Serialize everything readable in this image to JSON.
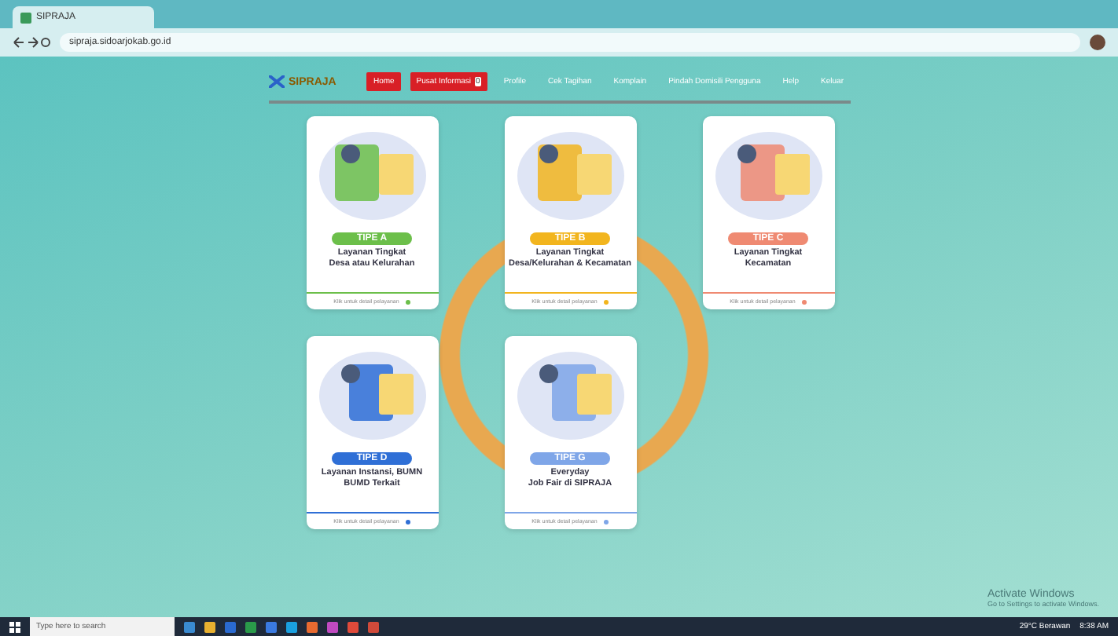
{
  "browser": {
    "tab_title": "SIPRAJA",
    "url": "sipraja.sidoarjokab.go.id"
  },
  "nav": {
    "logo": "SIPRAJA",
    "items": [
      {
        "label": "Home",
        "kind": "button"
      },
      {
        "label": "Pusat Informasi",
        "kind": "button",
        "badge": "0"
      },
      {
        "label": "Profile",
        "kind": "link"
      },
      {
        "label": "Cek Tagihan",
        "kind": "link"
      },
      {
        "label": "Komplain",
        "kind": "link"
      },
      {
        "label": "Pindah Domisili Pengguna",
        "kind": "link"
      },
      {
        "label": "Help",
        "kind": "link"
      },
      {
        "label": "Keluar",
        "kind": "link"
      }
    ]
  },
  "cards": [
    {
      "badge": "TIPE A",
      "title": "Layanan Tingkat\nDesa atau Kelurahan",
      "footer": "Klik untuk detail pelayanan",
      "color": "#6cbf4a"
    },
    {
      "badge": "TIPE B",
      "title": "Layanan Tingkat\nDesa/Kelurahan & Kecamatan",
      "footer": "Klik untuk detail pelayanan",
      "color": "#f2b51e"
    },
    {
      "badge": "TIPE C",
      "title": "Layanan Tingkat\nKecamatan",
      "footer": "Klik untuk detail pelayanan",
      "color": "#ef8a72"
    },
    {
      "badge": "TIPE D",
      "title": "Layanan Instansi, BUMN\nBUMD Terkait",
      "footer": "Klik untuk detail pelayanan",
      "color": "#2f6fd6"
    },
    {
      "badge": "TIPE G",
      "title": "Everyday\nJob Fair di SIPRAJA",
      "footer": "Klik untuk detail pelayanan",
      "color": "#7fa6e8"
    }
  ],
  "watermark_os": {
    "title": "Activate Windows",
    "text": "Go to Settings to activate Windows."
  },
  "taskbar": {
    "search_placeholder": "Type here to search",
    "weather": "29°C Berawan",
    "time": "8:38 AM"
  }
}
